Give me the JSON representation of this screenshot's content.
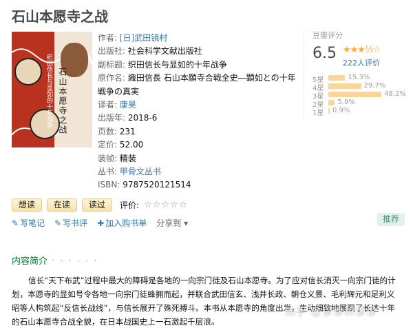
{
  "book": {
    "title": "石山本愿寺之战",
    "cover_text": "石山本愿寺之战",
    "cover_sub": "织田信长与显如的十年战争"
  },
  "info": {
    "author_label": "作者:",
    "author": "[日]武田镜村",
    "publisher_label": "出版社:",
    "publisher": "社会科学文献出版社",
    "subtitle_label": "副标题:",
    "subtitle": "织田信长与显如的十年战争",
    "original_label": "原作名:",
    "original": "織田信長 石山本願寺合戦全史―顕如との十年戦争の真実",
    "translator_label": "译者:",
    "translator": "康昊",
    "year_label": "出版年:",
    "year": "2018-6",
    "pages_label": "页数:",
    "pages": "231",
    "price_label": "定价:",
    "price": "52.00",
    "binding_label": "装帧:",
    "binding": "精装",
    "series_label": "丛书:",
    "series": "甲骨文丛书",
    "isbn_label": "ISBN:",
    "isbn": "9787520121514"
  },
  "rating": {
    "header": "豆瓣评分",
    "score": "6.5",
    "stars": "★★★½☆",
    "count": "222人评价",
    "dist": [
      {
        "label": "5星",
        "pct": "15.3%",
        "value": 15.3
      },
      {
        "label": "4星",
        "pct": "29.7%",
        "value": 29.7
      },
      {
        "label": "3星",
        "pct": "48.2%",
        "value": 48.2
      },
      {
        "label": "2星",
        "pct": "5.9%",
        "value": 5.9
      },
      {
        "label": "1星",
        "pct": "0.9%",
        "value": 0.9
      }
    ]
  },
  "actions": {
    "want": "想读",
    "reading": "在读",
    "read": "读过",
    "rate_label": "评价:",
    "empty_stars": "☆☆☆☆☆"
  },
  "tools": {
    "note": "写笔记",
    "review": "写书评",
    "cart": "加入购书单",
    "share": "分享到",
    "recommend": "推荐"
  },
  "section": {
    "title": "内容简介",
    "dots": "· · · · · ·"
  },
  "intro": "信长“天下布武”过程中最大的障碍是各地的一向宗门徒及石山本愿寺。为了应对信长消灭一向宗门徒的计划，本愿寺的显如号令各地一向宗门徒蜂拥而起，并联合武田信玄、浅井长政、朝仓义景、毛利辉元和足利义昭等人构筑起“反信长战线”，与信长展开了殊死搏斗。本书从本愿寺的角度出发，生动细致地展现了长达十年的石山本愿寺合战全貌，在日本战国史上一石激起千层浪。",
  "watermark": "知乎 @谬谬和谬谬"
}
